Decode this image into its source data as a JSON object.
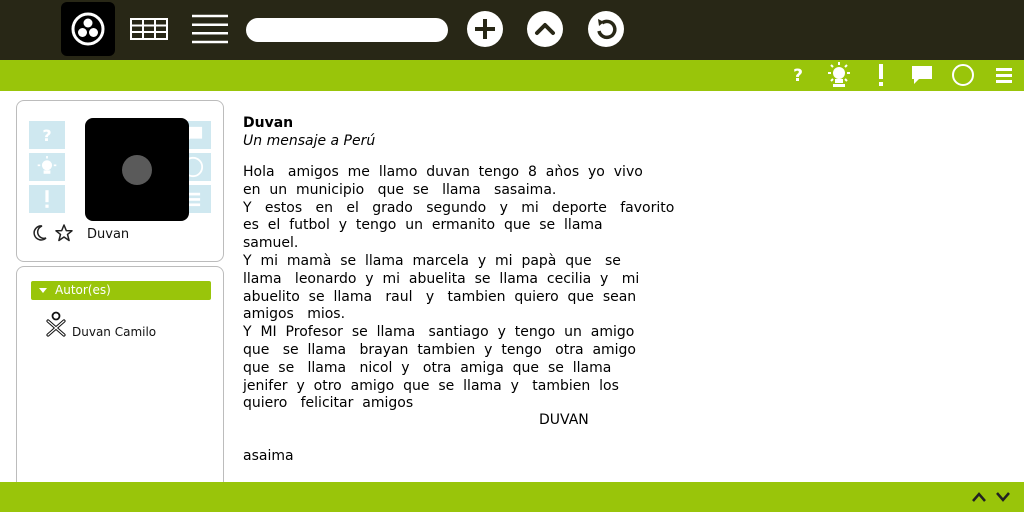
{
  "toolbar": {
    "icons": [
      "activity-icon",
      "grid-view-icon",
      "list-view-icon",
      "search-input",
      "add-icon",
      "up-icon",
      "refresh-icon"
    ],
    "search_placeholder": ""
  },
  "secondary_toolbar": {
    "icons": [
      "help-icon",
      "brightness-icon",
      "alert-icon",
      "chat-icon",
      "circle-icon",
      "menu-icon"
    ]
  },
  "profile": {
    "owner": "Duvan"
  },
  "authors": {
    "heading": "Autor(es)",
    "items": [
      "Duvan Camilo"
    ]
  },
  "post": {
    "title": "Duvan",
    "subtitle": "Un mensaje a Perú",
    "body": "Hola   amigos  me  llamo  duvan  tengo  8  aǹos  yo  vivo\nen  un  municipio   que  se   llama   sasaima.\nY   estos   en   el   grado   segundo   y   mi   deporte   favorito\nes  el  futbol  y  tengo  un  ermanito  que  se  llama\nsamuel.\nY  mi  mamà  se  llama  marcela  y  mi  papà  que   se\nllama   leonardo  y  mi  abuelita  se  llama  cecilia  y   mi\nabuelito  se  llama   raul   y   tambien  quiero  que  sean\namigos   mios.\nY  MI  Profesor  se  llama   santiago  y  tengo  un  amigo\nque   se  llama   brayan  tambien  y  tengo   otra  amigo\nque  se   llama   nicol  y   otra  amiga  que  se  llama\njenifer  y  otro  amigo  que  se  llama  y   tambien  los\nquiero   felicitar  amigos",
    "signature": "DUVAN",
    "footer": "asaima"
  },
  "colors": {
    "topbar": "#282716",
    "accent": "#99c50a",
    "palette_cell": "#cfe8f0"
  }
}
